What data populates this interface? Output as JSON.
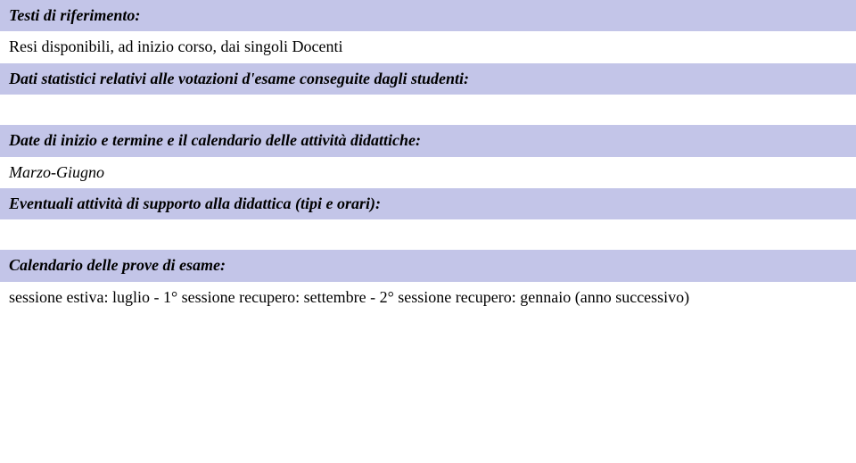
{
  "rows": {
    "r1": "Testi di riferimento:",
    "r2": "Resi disponibili, ad inizio corso, dai singoli Docenti",
    "r3": "Dati statistici relativi alle votazioni d'esame conseguite dagli studenti:",
    "r4": "",
    "r5": "Date di inizio e termine e il calendario delle attività didattiche:",
    "r6": "Marzo-Giugno",
    "r7": "Eventuali attività di supporto alla didattica (tipi e orari):",
    "r8": "",
    "r9": "Calendario delle prove di esame:",
    "r10": "sessione estiva: luglio - 1° sessione recupero: settembre - 2° sessione recupero: gennaio (anno successivo)"
  }
}
